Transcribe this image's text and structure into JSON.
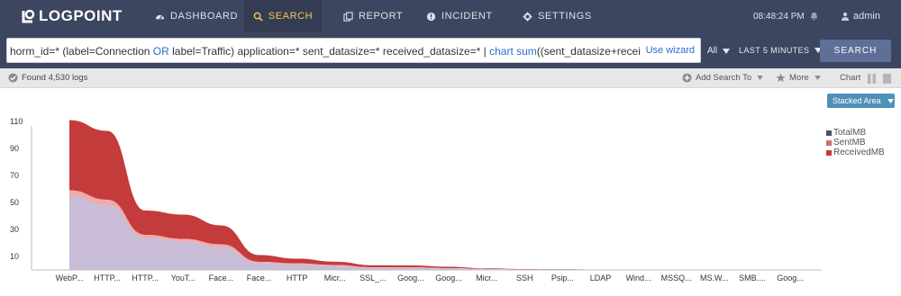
{
  "app": {
    "brand": "LOGPOINT"
  },
  "nav": {
    "items": [
      {
        "label": "DASHBOARD"
      },
      {
        "label": "SEARCH"
      },
      {
        "label": "REPORT"
      },
      {
        "label": "INCIDENT"
      },
      {
        "label": "SETTINGS"
      }
    ],
    "active": "SEARCH",
    "clock": "08:48:24 PM",
    "user": "admin"
  },
  "query": {
    "part1": "horm_id=* (label=Connection ",
    "kw_or": "OR",
    "part2": " label=Traffic) application=* sent_datasize=* received_datasize=* | ",
    "kw_chart": "chart sum",
    "part3": "((sent_datasize+received_da",
    "wizard_label": "Use wizard",
    "repo": "All",
    "time_range": "LAST 5 MINUTES",
    "search_button": "SEARCH"
  },
  "status": {
    "found": "Found 4,530 logs",
    "add_search_to": "Add Search To",
    "more": "More",
    "view_label": "Chart"
  },
  "chart_controls": {
    "mode": "Stacked Area"
  },
  "chart_data": {
    "type": "area",
    "stacked": true,
    "categories": [
      "WebP...",
      "HTTP...",
      "HTTP...",
      "YouT...",
      "Face...",
      "Face...",
      "HTTP",
      "Micr...",
      "SSL_...",
      "Goog...",
      "Goog...",
      "Micr...",
      "SSH",
      "Psip...",
      "LDAP",
      "Wind...",
      "MSSQ...",
      "MS.W...",
      "SMB....",
      "Goog..."
    ],
    "ylim": [
      0,
      120
    ],
    "yticks": [
      10,
      30,
      50,
      70,
      90,
      110
    ],
    "grid": false,
    "legend_position": "right",
    "series": [
      {
        "name": "TotalMB",
        "color": "#4b5272",
        "values": [
          55,
          48,
          24,
          21,
          17,
          5,
          4,
          3,
          1.5,
          1.5,
          1,
          0.5,
          0.3,
          0.2,
          0.1,
          0.1,
          0.1,
          0.05,
          0.05,
          0
        ]
      },
      {
        "name": "SentMB",
        "color": "#d46a6a",
        "values": [
          4,
          4,
          2,
          2,
          2,
          1,
          0.8,
          0.6,
          0.4,
          0.3,
          0.3,
          0.2,
          0.1,
          0.1,
          0.05,
          0.05,
          0.05,
          0.02,
          0.02,
          0
        ]
      },
      {
        "name": "ReceivedMB",
        "color": "#c43b3b",
        "values": [
          52,
          51,
          18,
          18,
          14,
          5,
          3.5,
          2.5,
          1.5,
          1.5,
          1,
          0.5,
          0.3,
          0.2,
          0.1,
          0.1,
          0.1,
          0.05,
          0.05,
          0
        ]
      }
    ],
    "fill_colors": [
      "#c9bcd7",
      "#f0aaa6",
      "#c43b3b"
    ]
  }
}
